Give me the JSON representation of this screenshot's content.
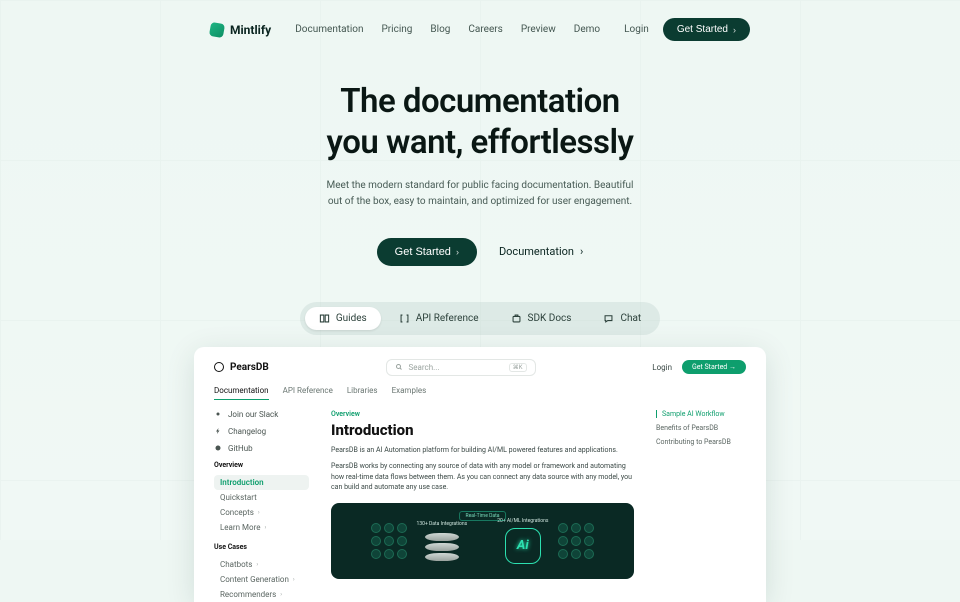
{
  "brand": {
    "name": "Mintlify"
  },
  "nav": {
    "links": [
      "Documentation",
      "Pricing",
      "Blog",
      "Careers",
      "Preview",
      "Demo"
    ],
    "login": "Login",
    "cta": "Get Started"
  },
  "hero": {
    "h1_line1": "The documentation",
    "h1_line2": "you want, effortlessly",
    "sub": "Meet the modern standard for public facing documentation. Beautiful out of the box, easy to maintain, and optimized for user engagement.",
    "primary": "Get Started",
    "secondary": "Documentation"
  },
  "tabs": [
    "Guides",
    "API Reference",
    "SDK Docs",
    "Chat"
  ],
  "preview": {
    "brand": "PearsDB",
    "search_placeholder": "Search...",
    "search_key": "⌘K",
    "login": "Login",
    "cta": "Get Started →",
    "toptabs": [
      "Documentation",
      "API Reference",
      "Libraries",
      "Examples"
    ],
    "pills": [
      "Join our Slack",
      "Changelog",
      "GitHub"
    ],
    "side_head1": "Overview",
    "side1": [
      "Introduction",
      "Quickstart",
      "Concepts",
      "Learn More"
    ],
    "side_head2": "Use Cases",
    "side2": [
      "Chatbots",
      "Content Generation",
      "Recommenders"
    ],
    "crumb": "Overview",
    "title": "Introduction",
    "p1": "PearsDB is an AI Automation platform for building AI/ML powered features and applications.",
    "p2": "PearsDB works by connecting any source of data with any model or framework and automating how real-time data flows between them. As you can connect any data source with any model, you can build and automate any use case.",
    "g_realtime": "Real-Time Data",
    "g_left": "130+ Data Integrations",
    "g_right": "20+ AI/ML Integrations",
    "toc": [
      "Sample AI Workflow",
      "Benefits of PearsDB",
      "Contributing to PearsDB"
    ]
  }
}
